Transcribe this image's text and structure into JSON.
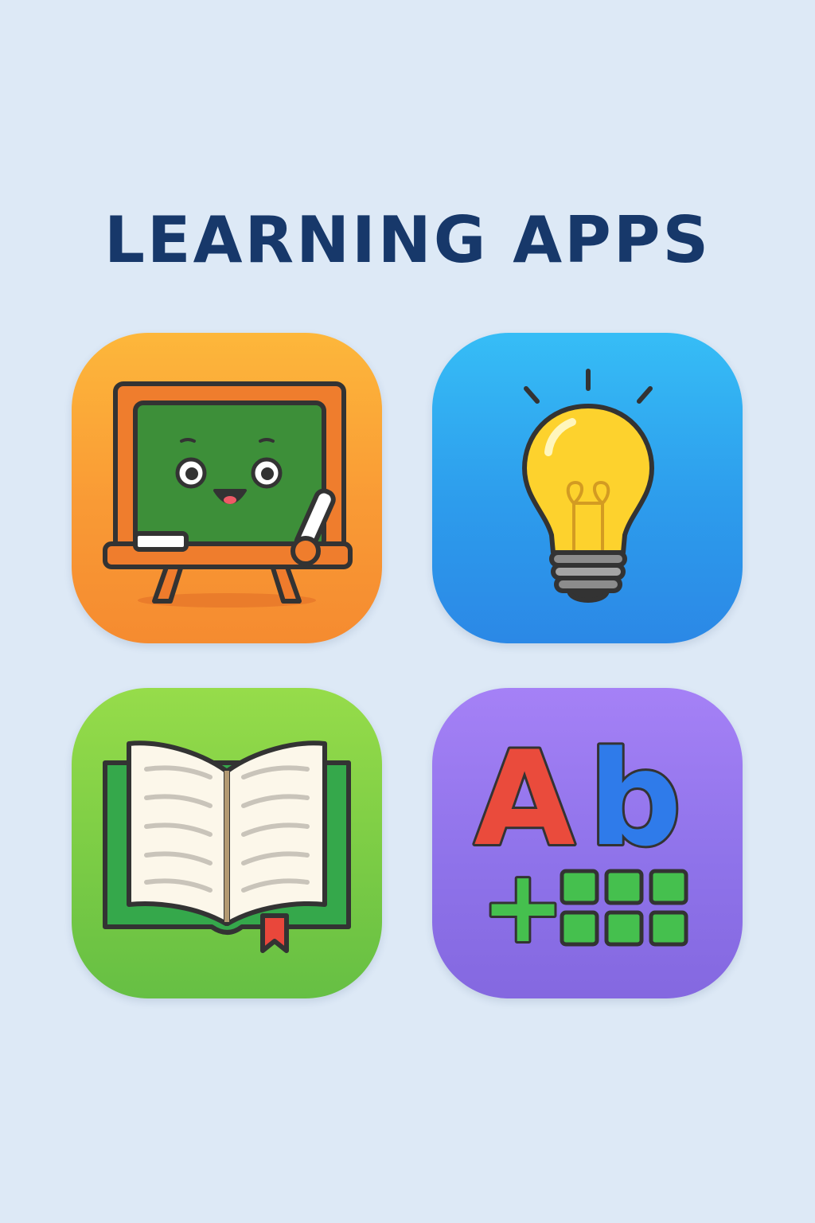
{
  "page": {
    "title": "LEARNING APPS"
  },
  "apps": [
    {
      "icon": "chalkboard-icon",
      "color": "#f99a35"
    },
    {
      "icon": "lightbulb-icon",
      "color": "#2d9cec"
    },
    {
      "icon": "open-book-icon",
      "color": "#7bcc45"
    },
    {
      "icon": "alphabet-math-icon",
      "color": "#8f73ea"
    }
  ],
  "abc_icon": {
    "letter_upper": "A",
    "letter_lower": "b",
    "symbol": "+"
  },
  "colors": {
    "background": "#dde9f6",
    "title": "#17386a",
    "outline": "#333333"
  }
}
